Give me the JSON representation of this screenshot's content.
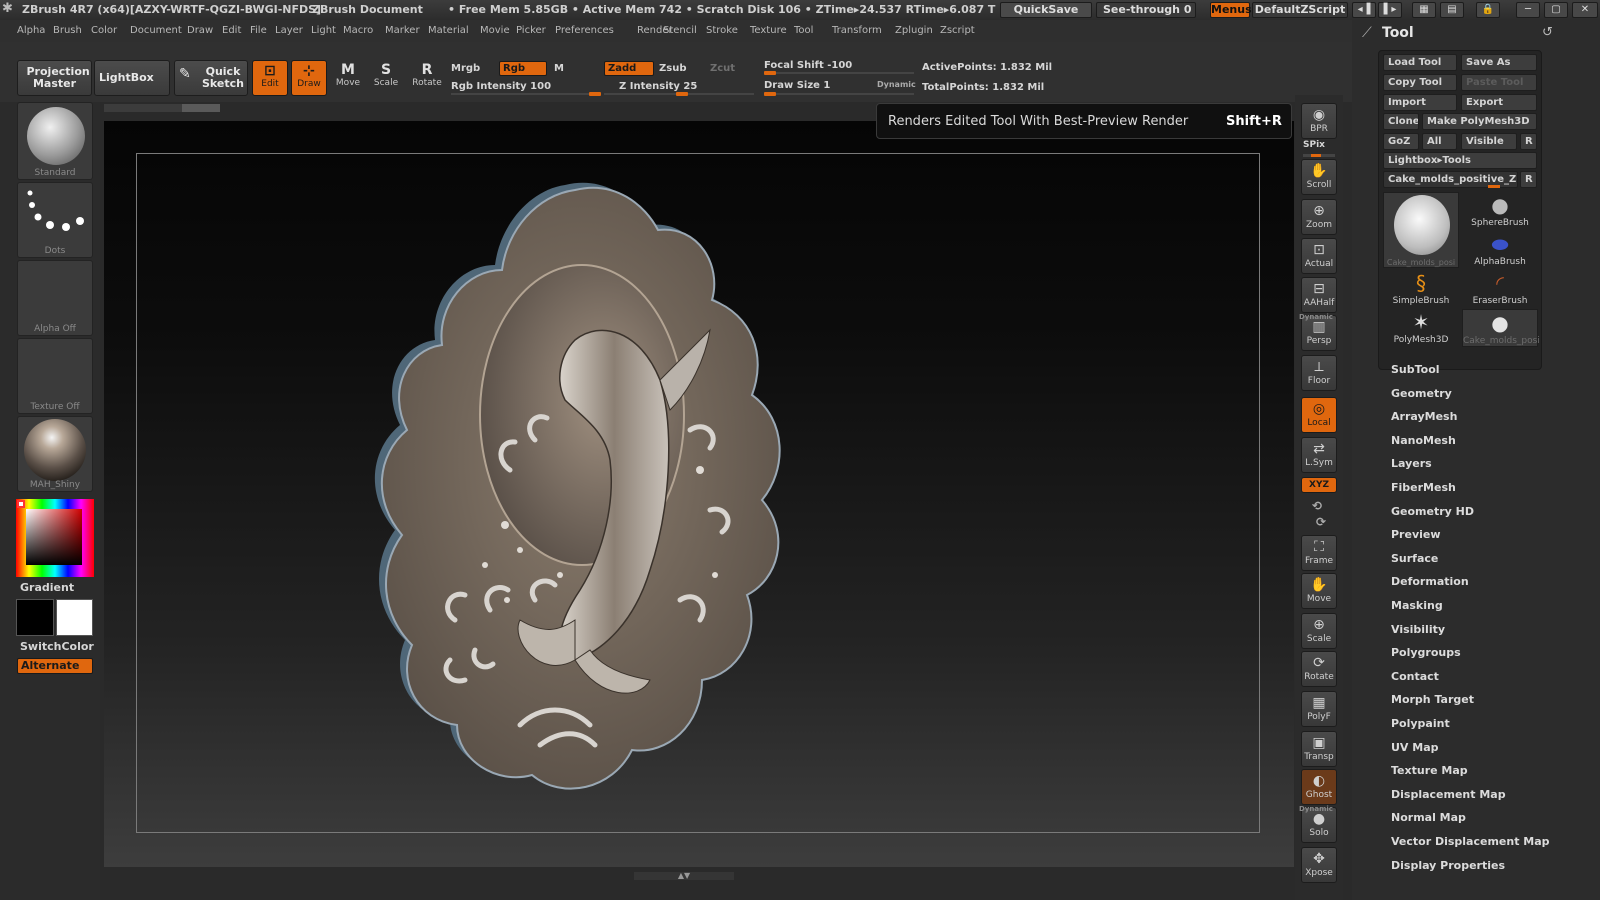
{
  "titlebar": {
    "app": "ZBrush 4R7 (x64)[AZXY-WRTF-QGZI-BWGI-NFDS]",
    "document": "ZBrush Document",
    "stats": "• Free Mem 5.85GB • Active Mem 742 • Scratch Disk 106 • ZTime▸24.537 RTime▸6.087 T",
    "quicksave": "QuickSave",
    "see_through": "See-through 0",
    "menus": "Menus",
    "script": "DefaultZScript"
  },
  "menubar": [
    "Alpha",
    "Brush",
    "Color",
    "Document",
    "Draw",
    "Edit",
    "File",
    "Layer",
    "Light",
    "Macro",
    "Marker",
    "Material",
    "Movie",
    "Picker",
    "Preferences",
    "Render",
    "Stencil",
    "Stroke",
    "Texture",
    "Tool",
    "Transform",
    "Zplugin",
    "Zscript"
  ],
  "toolbar": {
    "projection_master": "Projection Master",
    "lightbox": "LightBox",
    "quick_sketch": "Quick Sketch",
    "edit": "Edit",
    "draw": "Draw",
    "move": "Move",
    "scale": "Scale",
    "rotate": "Rotate",
    "mrgb": "Mrgb",
    "rgb": "Rgb",
    "m": "M",
    "zadd": "Zadd",
    "zsub": "Zsub",
    "zcut": "Zcut",
    "rgb_intensity": "Rgb Intensity 100",
    "z_intensity": "Z Intensity 25",
    "focal_shift": "Focal Shift -100",
    "draw_size": "Draw Size 1",
    "dynamic": "Dynamic",
    "active_points": "ActivePoints: 1.832 Mil",
    "total_points": "TotalPoints: 1.832 Mil"
  },
  "tooltip": {
    "text": "Renders Edited Tool With Best-Preview Render",
    "shortcut": "Shift+R"
  },
  "leftshelf": {
    "brush": "Standard",
    "stroke": "Dots",
    "alpha": "Alpha Off",
    "texture": "Texture Off",
    "material": "MAH_Shiny",
    "gradient": "Gradient",
    "switchcolor": "SwitchColor",
    "alternate": "Alternate"
  },
  "rightshelf": [
    "BPR",
    "SPix",
    "Scroll",
    "Zoom",
    "Actual",
    "AAHalf",
    "Persp",
    "Floor",
    "Local",
    "L.Sym",
    "XYZ",
    "Frame",
    "Move",
    "Scale",
    "Rotate",
    "PolyF",
    "Transp",
    "Ghost",
    "Solo",
    "Xpose"
  ],
  "rightshelf_dynamic": "Dynamic",
  "palette": {
    "title": "Tool",
    "load_tool": "Load Tool",
    "save_as": "Save As",
    "copy_tool": "Copy Tool",
    "paste_tool": "Paste Tool",
    "import": "Import",
    "export": "Export",
    "clone": "Clone",
    "make_polymesh": "Make PolyMesh3D",
    "goz": "GoZ",
    "all": "All",
    "visible": "Visible",
    "r": "R",
    "lightbox_tools": "Lightbox▸Tools",
    "current_tool": "Cake_molds_positive_Z",
    "thumbs": [
      "Cake_molds_posi",
      "SphereBrush",
      "AlphaBrush",
      "SimpleBrush",
      "EraserBrush",
      "PolyMesh3D",
      "Cake_molds_posi"
    ],
    "sections": [
      "SubTool",
      "Geometry",
      "ArrayMesh",
      "NanoMesh",
      "Layers",
      "FiberMesh",
      "Geometry HD",
      "Preview",
      "Surface",
      "Deformation",
      "Masking",
      "Visibility",
      "Polygroups",
      "Contact",
      "Morph Target",
      "Polypaint",
      "UV Map",
      "Texture Map",
      "Displacement Map",
      "Normal Map",
      "Vector Displacement Map",
      "Display Properties"
    ]
  },
  "colors": {
    "accent": "#e0670e",
    "panel": "#2c2c2c",
    "viewport_top": "#050505",
    "viewport_bottom": "#3d3d3d"
  }
}
